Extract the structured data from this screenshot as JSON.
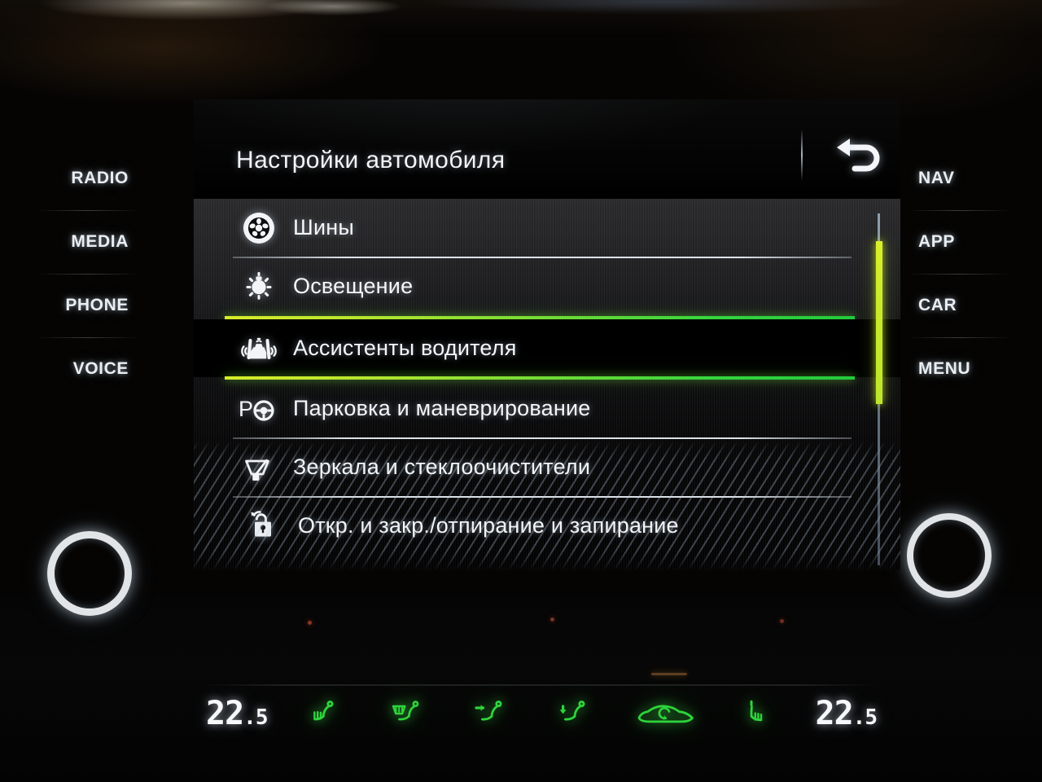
{
  "screen": {
    "title": "Настройки автомобиля",
    "back_icon": "back-arrow-icon",
    "menu_items": [
      {
        "label": "Шины",
        "icon": "tire-icon",
        "selected": false
      },
      {
        "label": "Освещение",
        "icon": "light-bulb-icon",
        "selected": false
      },
      {
        "label": "Ассистенты водителя",
        "icon": "driver-assist-icon",
        "selected": true
      },
      {
        "label": "Парковка и маневрирование",
        "icon": "parking-icon",
        "selected": false
      },
      {
        "label": "Зеркала и стеклоочистители",
        "icon": "wiper-icon",
        "selected": false
      },
      {
        "label": "Откр. и закр./отпирание и запирание",
        "icon": "unlock-icon",
        "selected": false
      }
    ],
    "scrollbar": {
      "name": "list-scrollbar",
      "thumb_position_percent": 8,
      "thumb_size_percent": 46
    }
  },
  "side_left": {
    "buttons": [
      {
        "label": "RADIO"
      },
      {
        "label": "MEDIA"
      },
      {
        "label": "PHONE"
      },
      {
        "label": "VOICE"
      }
    ]
  },
  "side_right": {
    "buttons": [
      {
        "label": "NAV"
      },
      {
        "label": "APP"
      },
      {
        "label": "CAR"
      },
      {
        "label": "MENU"
      }
    ]
  },
  "climate": {
    "temp_left_int": "22",
    "temp_left_dec": ".5",
    "temp_right_int": "22",
    "temp_right_dec": ".5",
    "icons": [
      {
        "name": "seat-heat-left-icon"
      },
      {
        "name": "seat-defrost-left-icon"
      },
      {
        "name": "airflow-face-left-icon"
      },
      {
        "name": "airflow-feet-right-icon"
      },
      {
        "name": "recirculation-car-icon"
      },
      {
        "name": "seat-heat-right-icon"
      }
    ]
  },
  "knobs": {
    "left": "volume-knob",
    "right": "tuner-knob"
  },
  "colors": {
    "highlight_green_start": "#d8ec2a",
    "highlight_green_end": "#23c93c",
    "scrollbar_thumb": "#cfee2b",
    "climate_green": "#2ed43c",
    "text": "#f4f6f8"
  }
}
